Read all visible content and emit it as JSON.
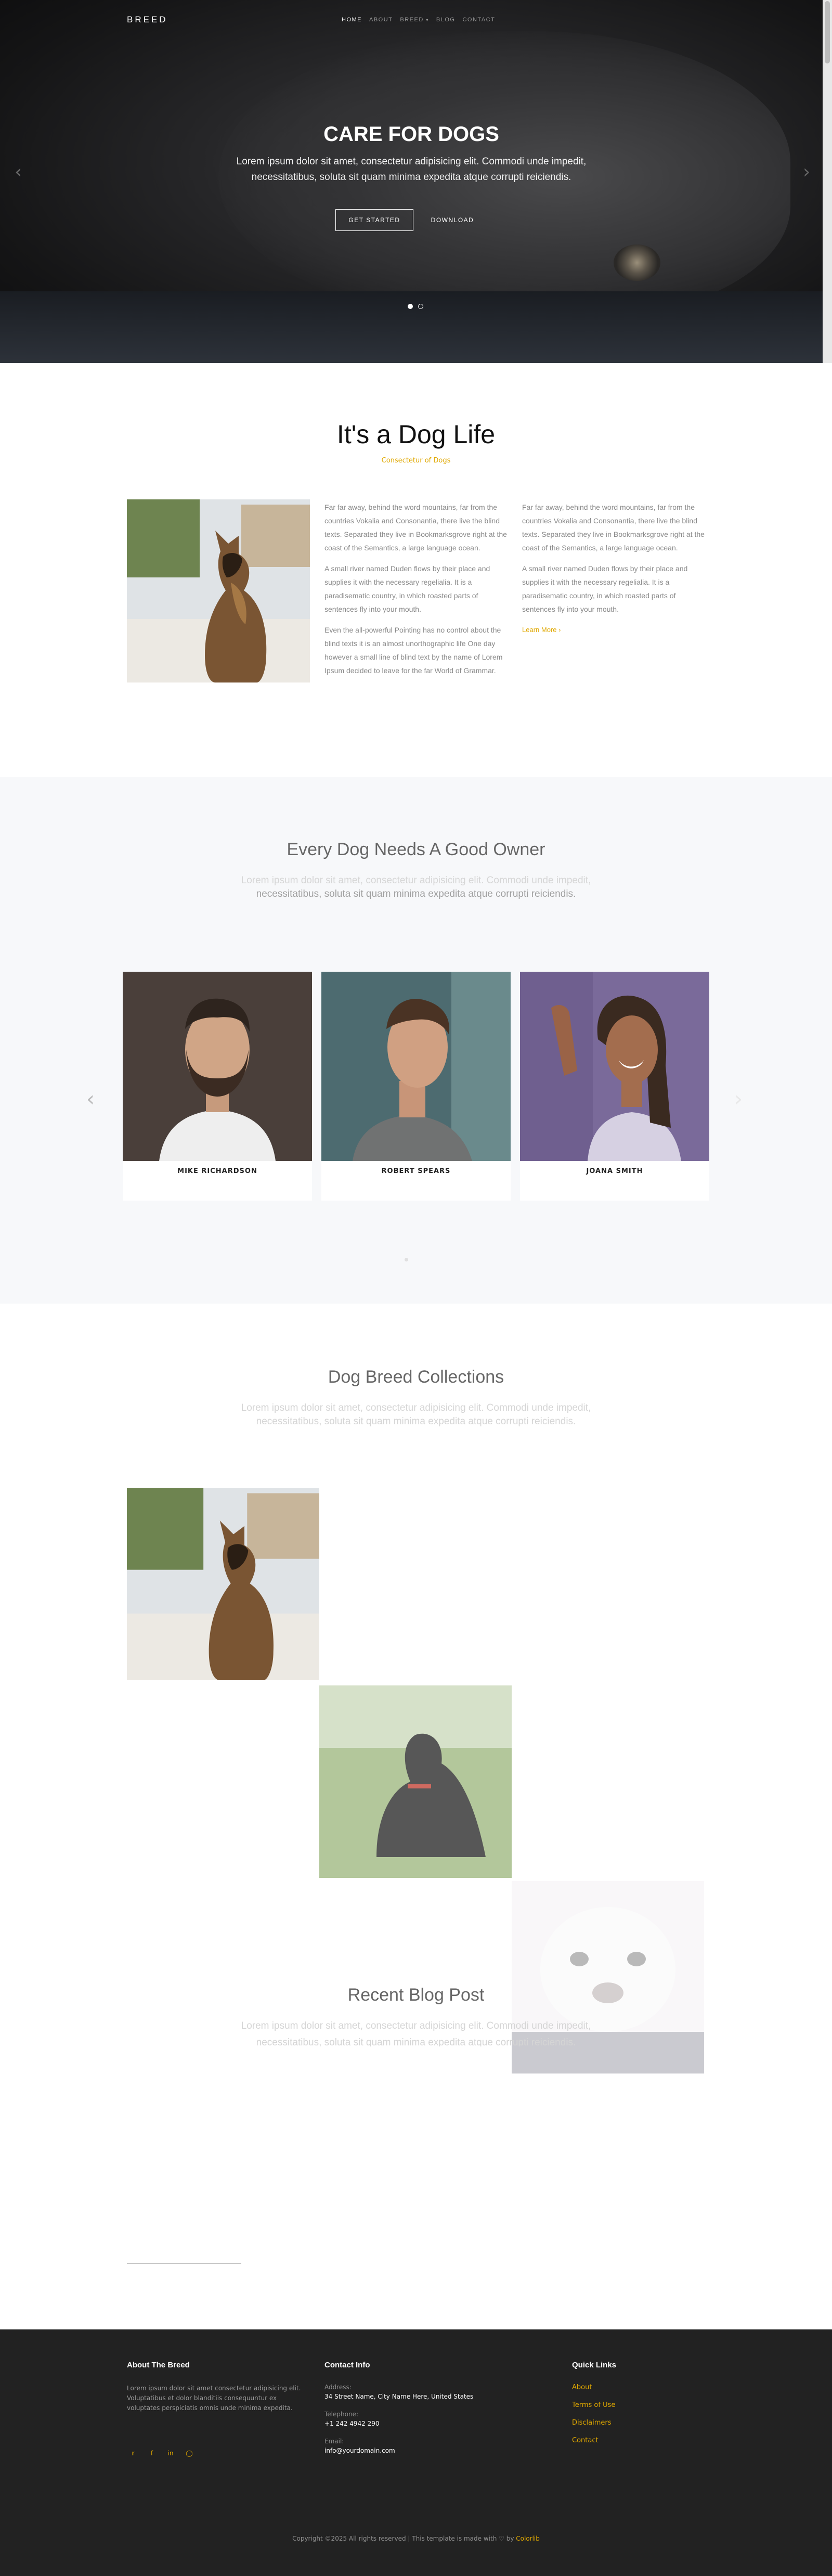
{
  "nav": {
    "brand": "BREED",
    "items": [
      "HOME",
      "ABOUT",
      "BREED",
      "BLOG",
      "CONTACT"
    ]
  },
  "hero": {
    "title": "CARE FOR DOGS",
    "subtitle_line1": "Lorem ipsum dolor sit amet, consectetur adipisicing elit. Commodi unde impedit,",
    "subtitle_line2": "necessitatibus, soluta sit quam minima expedita atque corrupti reiciendis.",
    "btn_start": "GET STARTED",
    "btn_download": "DOWNLOAD",
    "slide_count": 2,
    "active_slide": 1
  },
  "about": {
    "title": "It's a Dog Life",
    "subtitle": "Consectetur of Dogs",
    "col1": [
      "Far far away, behind the word mountains, far from the countries Vokalia and Consonantia, there live the blind texts. Separated they live in Bookmarksgrove right at the coast of the Semantics, a large language ocean.",
      "A small river named Duden flows by their place and supplies it with the necessary regelialia. It is a paradisematic country, in which roasted parts of sentences fly into your mouth.",
      "Even the all-powerful Pointing has no control about the blind texts it is an almost unorthographic life One day however a small line of blind text by the name of Lorem Ipsum decided to leave for the far World of Grammar."
    ],
    "col2": [
      "Far far away, behind the word mountains, far from the countries Vokalia and Consonantia, there live the blind texts. Separated they live in Bookmarksgrove right at the coast of the Semantics, a large language ocean.",
      "A small river named Duden flows by their place and supplies it with the necessary regelialia. It is a paradisematic country, in which roasted parts of sentences fly into your mouth."
    ],
    "read_more": "Learn More ›"
  },
  "owners": {
    "title": "Every Dog Needs A Good Owner",
    "subtitle_line1": "Lorem ipsum dolor sit amet, consectetur adipisicing elit. Commodi unde impedit,",
    "subtitle_line2": "necessitatibus, soluta sit quam minima expedita atque corrupti reiciendis.",
    "people": [
      {
        "name": "MIKE RICHARDSON",
        "photo": "bearded-man-photo"
      },
      {
        "name": "ROBERT SPEARS",
        "photo": "man-profile-photo"
      },
      {
        "name": "JOANA SMITH",
        "photo": "smiling-woman-photo"
      }
    ]
  },
  "collections": {
    "title": "Dog Breed Collections",
    "subtitle_line1": "Lorem ipsum dolor sit amet, consectetur adipisicing elit. Commodi unde impedit,",
    "subtitle_line2": "necessitatibus, soluta sit quam minima expedita atque corrupti reiciendis."
  },
  "blog": {
    "title": "Recent Blog Post",
    "subtitle_line1": "Lorem ipsum dolor sit amet, consectetur adipisicing elit. Commodi unde impedit,",
    "subtitle_line2": "necessitatibus, soluta sit quam minima expedita atque corrupti reiciendis."
  },
  "footer": {
    "about_title": "About The Breed",
    "about_text": "Lorem ipsum dolor sit amet consectetur adipisicing elit. Voluptatibus et dolor blanditiis consequuntur ex voluptates perspiciatis omnis unde minima expedita.",
    "contact_title": "Contact Info",
    "address_label": "Address:",
    "address_value": "34 Street Name, City Name Here, United States",
    "phone_label": "Telephone:",
    "phone_value": "+1 242 4942 290",
    "email_label": "Email:",
    "email_value": "info@yourdomain.com",
    "links_title": "Quick Links",
    "links": [
      "About",
      "Terms of Use",
      "Disclaimers",
      "Contact"
    ],
    "social_icons": [
      "twitter-icon",
      "facebook-icon",
      "linkedin-icon",
      "instagram-icon"
    ],
    "copyright_prefix": "Copyright ©2025 All rights reserved | This template is made with",
    "copyright_by": "by",
    "copyright_link": "Colorlib"
  },
  "colors": {
    "accent": "#e0a800",
    "footer_bg": "#222222",
    "section_bg": "#f7f8fa"
  }
}
